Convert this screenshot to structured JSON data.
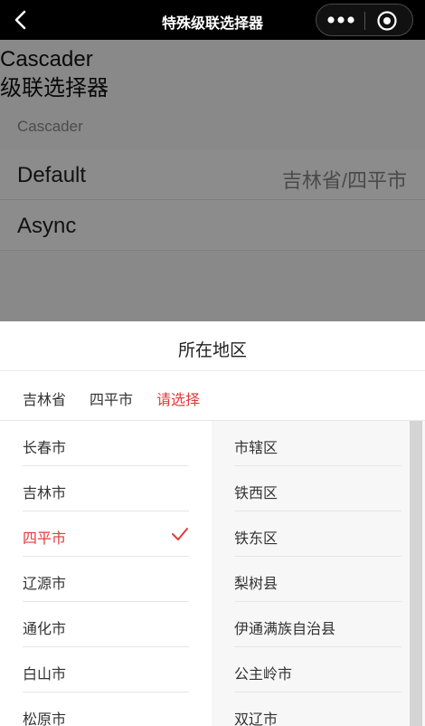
{
  "navbar": {
    "title": "特殊级联选择器",
    "back_icon": "back-arrow-icon",
    "more_icon": "more-dots-icon",
    "capsule_icon": "target-icon"
  },
  "page": {
    "title": "Cascader\n级联选择器",
    "section_label": "Cascader",
    "cells": [
      {
        "title": "Default",
        "value": "吉林省/四平市"
      },
      {
        "title": "Async",
        "value": ""
      }
    ]
  },
  "sheet": {
    "title": "所在地区",
    "tabs": [
      {
        "label": "吉林省",
        "active": false
      },
      {
        "label": "四平市",
        "active": false
      },
      {
        "label": "请选择",
        "active": true
      }
    ],
    "cities": [
      {
        "label": "长春市",
        "selected": false
      },
      {
        "label": "吉林市",
        "selected": false
      },
      {
        "label": "四平市",
        "selected": true
      },
      {
        "label": "辽源市",
        "selected": false
      },
      {
        "label": "通化市",
        "selected": false
      },
      {
        "label": "白山市",
        "selected": false
      },
      {
        "label": "松原市",
        "selected": false
      }
    ],
    "districts": [
      {
        "label": "市辖区"
      },
      {
        "label": "铁西区"
      },
      {
        "label": "铁东区"
      },
      {
        "label": "梨树县"
      },
      {
        "label": "伊通满族自治县"
      },
      {
        "label": "公主岭市"
      },
      {
        "label": "双辽市"
      }
    ]
  },
  "colors": {
    "accent": "#e4393c",
    "navbar_bg": "#000000",
    "mask": "rgba(0,0,0,0.45)"
  }
}
